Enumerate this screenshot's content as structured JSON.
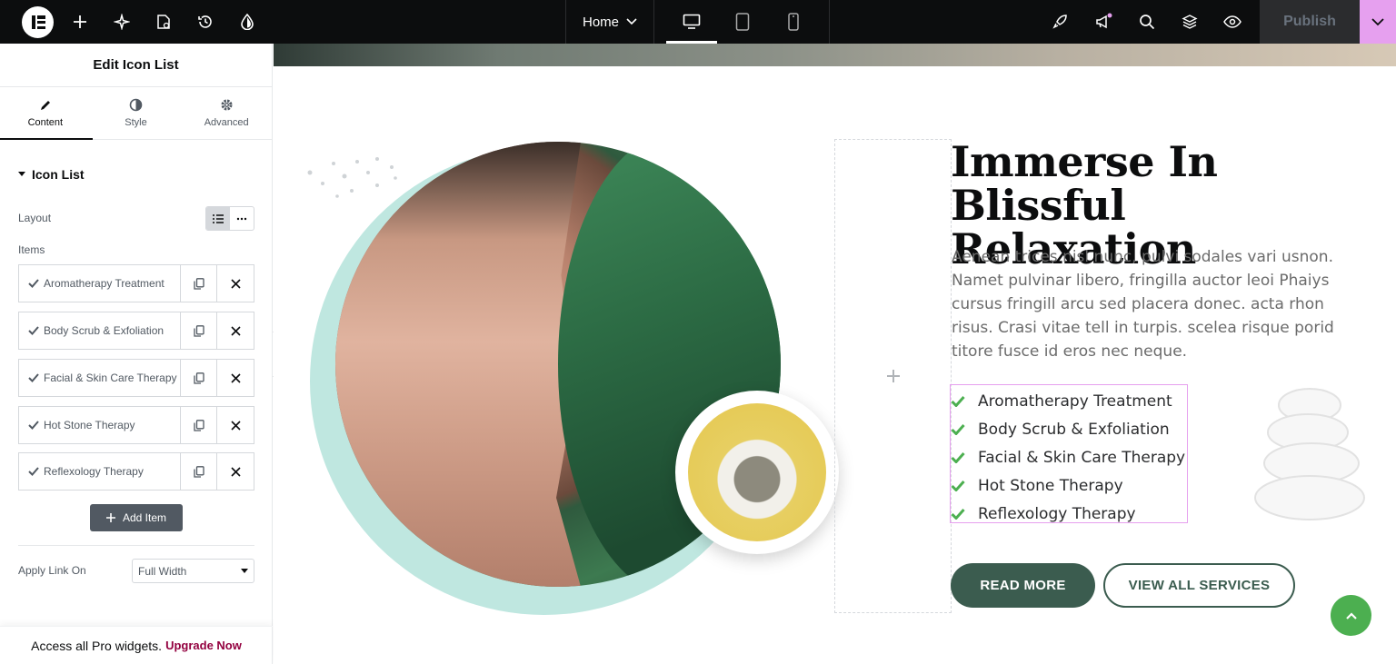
{
  "topbar": {
    "page_name": "Home",
    "publish_label": "Publish",
    "accent_color": "#e6a0ef"
  },
  "panel": {
    "title": "Edit Icon List",
    "tabs": [
      {
        "label": "Content",
        "icon": "pencil-icon",
        "active": true
      },
      {
        "label": "Style",
        "icon": "half-circle-icon",
        "active": false
      },
      {
        "label": "Advanced",
        "icon": "gear-icon",
        "active": false
      }
    ],
    "section_title": "Icon List",
    "layout_label": "Layout",
    "items_label": "Items",
    "items": [
      {
        "label": "Aromatherapy Treatment"
      },
      {
        "label": "Body Scrub & Exfoliation"
      },
      {
        "label": "Facial & Skin Care Therapy"
      },
      {
        "label": "Hot Stone Therapy"
      },
      {
        "label": "Reflexology Therapy"
      }
    ],
    "add_item_label": "Add Item",
    "apply_link_label": "Apply Link On",
    "apply_link_value": "Full Width",
    "promo_text": "Access all Pro widgets.",
    "promo_link": "Upgrade Now"
  },
  "canvas": {
    "headline": "Immerse In Blissful Relaxation",
    "body": "Aenean trices nisl nunc, pulvi sodales vari usnon. Namet pulvinar libero, fringilla auctor leoi Phaiys cursus fringill arcu sed placera donec. acta rhon risus. Crasi vitae tell in turpis. scelea risque porid titore fusce id eros nec neque.",
    "icon_list": [
      "Aromatherapy Treatment",
      "Body Scrub & Exfoliation",
      "Facial & Skin Care Therapy",
      "Hot Stone Therapy",
      "Reflexology Therapy"
    ],
    "read_more_label": "READ MORE",
    "view_all_label": "VIEW ALL SERVICES",
    "check_color": "#4caf50",
    "brand_green": "#3b5c4f"
  }
}
